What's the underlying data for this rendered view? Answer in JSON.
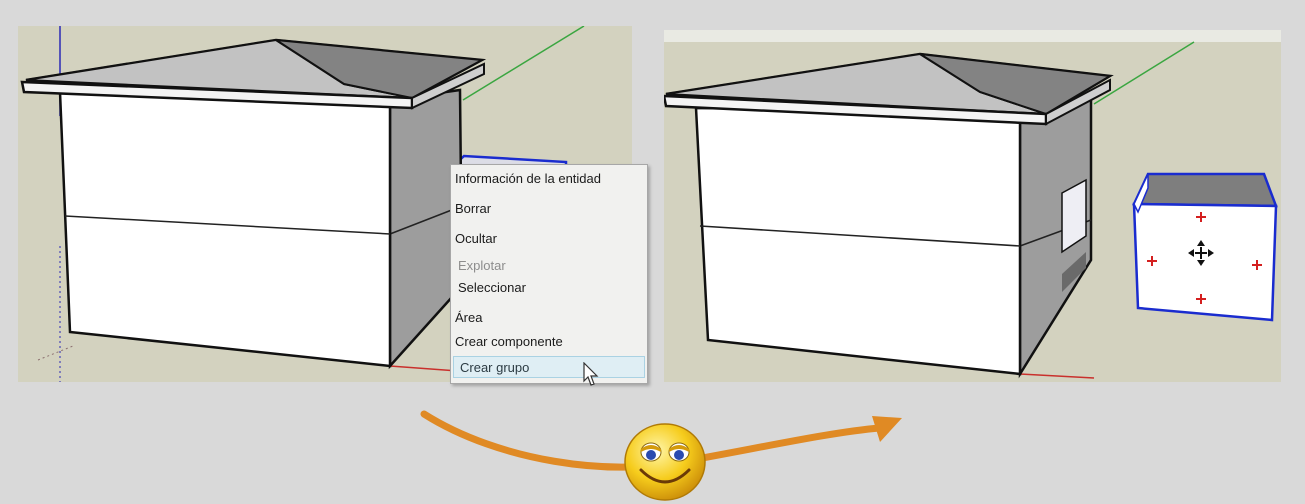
{
  "left_viewport": {
    "context_menu": {
      "items": [
        {
          "label": "Información de la entidad",
          "state": "normal"
        },
        {
          "label": "Borrar",
          "state": "normal"
        },
        {
          "label": "Ocultar",
          "state": "normal"
        },
        {
          "label": "Explotar",
          "state": "disabled"
        },
        {
          "label": "Seleccionar",
          "state": "normal"
        },
        {
          "label": "Área",
          "state": "normal"
        },
        {
          "label": "Crear componente",
          "state": "normal"
        },
        {
          "label": "Crear grupo",
          "state": "hovered"
        }
      ]
    }
  },
  "icons": {
    "cursor": "mouse-pointer-icon",
    "move": "move-cross-icon",
    "transition_arrow": "curved-arrow-icon",
    "emoticon": "smiley-icon"
  },
  "colors": {
    "background": "#d9d9d9",
    "viewport_ground": "#d3d2bf",
    "selection": "#1a2ccf",
    "axis_green": "#3aa640",
    "axis_red": "#c9302c",
    "arrow": "#e08a24",
    "smiley": "#f2c10f"
  }
}
